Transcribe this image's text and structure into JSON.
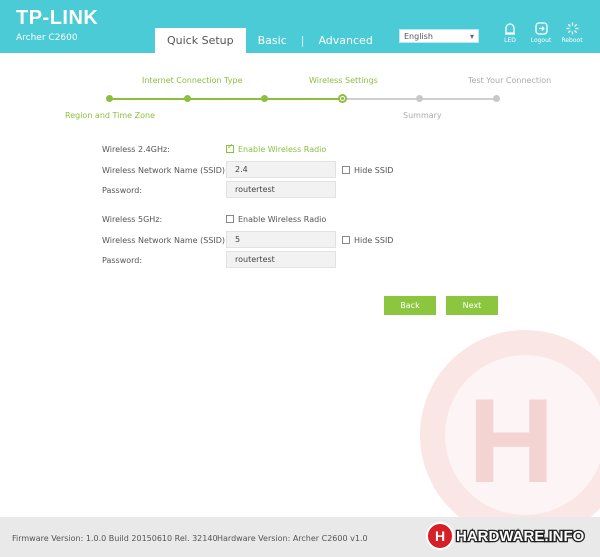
{
  "header": {
    "brand": "TP-LINK",
    "model": "Archer C2600",
    "tabs": [
      {
        "label": "Quick Setup",
        "active": true
      },
      {
        "label": "Basic",
        "active": false
      },
      {
        "label": "Advanced",
        "active": false
      }
    ],
    "language": "English",
    "icons": [
      {
        "name": "led-icon",
        "label": "LED"
      },
      {
        "name": "logout-icon",
        "label": "Logout"
      },
      {
        "name": "reboot-icon",
        "label": "Reboot"
      }
    ]
  },
  "steps": {
    "top": [
      "Internet Connection Type",
      "Wireless Settings",
      "Test Your Connection"
    ],
    "bottom": [
      "Region and Time Zone",
      "Summary"
    ],
    "current": 4,
    "total": 6
  },
  "wireless24": {
    "label": "Wireless 2.4GHz:",
    "enable_label": "Enable Wireless Radio",
    "enabled": true,
    "ssid_label": "Wireless Network Name (SSID):",
    "ssid": "2.4",
    "hide_ssid_label": "Hide SSID",
    "password_label": "Password:",
    "password": "routertest"
  },
  "wireless5": {
    "label": "Wireless 5GHz:",
    "enable_label": "Enable Wireless Radio",
    "enabled": false,
    "ssid_label": "Wireless Network Name (SSID):",
    "ssid": "5",
    "hide_ssid_label": "Hide SSID",
    "password_label": "Password:",
    "password": "routertest"
  },
  "buttons": {
    "back": "Back",
    "next": "Next"
  },
  "footer": {
    "firmware": "Firmware Version: 1.0.0 Build 20150610 Rel. 32140",
    "hardware": "Hardware Version: Archer C2600 v1.0"
  },
  "watermark": {
    "text": "HARDWARE.INFO"
  },
  "colors": {
    "header": "#4acbd6",
    "accent": "#8cbf3f",
    "button": "#8cc63f"
  }
}
